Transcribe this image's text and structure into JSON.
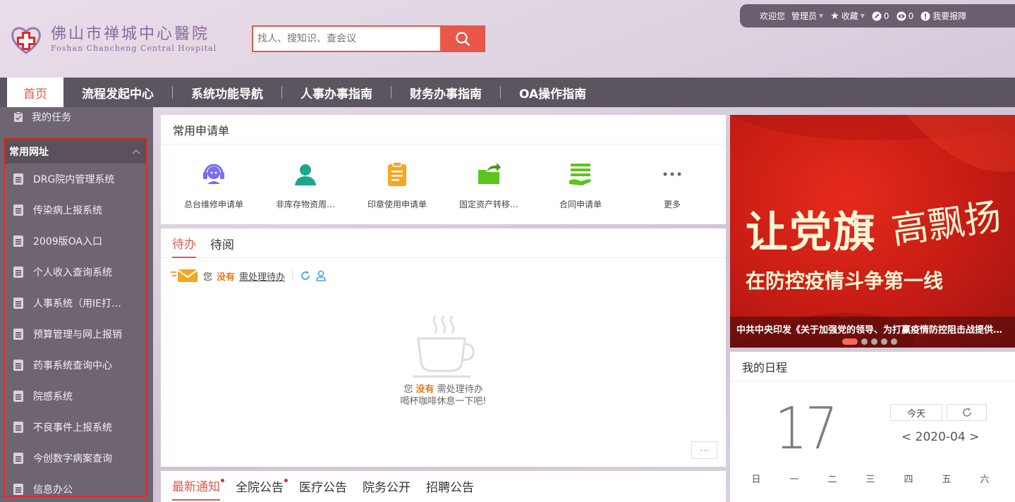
{
  "header": {
    "logo_cn": "佛山市禅城中心醫院",
    "logo_en": "Foshan Chancheng Central Hospital",
    "search_placeholder": "找人、搜知识、查会议"
  },
  "userbar": {
    "welcome": "欢迎您",
    "user": "管理员",
    "favorites": "收藏",
    "edit_count": "0",
    "view_count": "0",
    "report": "我要报障"
  },
  "nav": {
    "items": [
      "首页",
      "流程发起中心",
      "系统功能导航",
      "人事办事指南",
      "财务办事指南",
      "OA操作指南"
    ]
  },
  "sidebar": {
    "task": "我的任务",
    "section_title": "常用网址",
    "items": [
      "DRG院内管理系统",
      "传染病上报系统",
      "2009版OA入口",
      "个人收入查询系统",
      "人事系统（用IE打…",
      "预算管理与网上报销",
      "药事系统查询中心",
      "院感系统",
      "不良事件上报系统",
      "今创数字病案查询",
      "信息办公"
    ]
  },
  "apps": {
    "title": "常用申请单",
    "items": [
      {
        "label": "总台维修申请单",
        "icon": "headset-icon",
        "color": "#7b6cf0"
      },
      {
        "label": "非库存物资周…",
        "icon": "user-icon",
        "color": "#1ba88a"
      },
      {
        "label": "印章使用申请单",
        "icon": "clipboard-icon",
        "color": "#f5a623"
      },
      {
        "label": "固定资产转移…",
        "icon": "folder-share-icon",
        "color": "#5cc51c"
      },
      {
        "label": "合同申请单",
        "icon": "contract-hand-icon",
        "color": "#5cc51c"
      },
      {
        "label": "更多",
        "icon": "more-dots-icon",
        "color": "#666666"
      }
    ]
  },
  "todo": {
    "tabs": [
      "待办",
      "待阅"
    ],
    "line_prefix": "您",
    "line_none": "没有",
    "line_link": "需处理待办",
    "empty_prefix": "您",
    "empty_none": "没有",
    "empty_suffix": "需处理待办",
    "empty_line2": "喝杯咖啡休息一下吧!",
    "more": "···"
  },
  "notice": {
    "tabs": [
      "最新通知",
      "全院公告",
      "医疗公告",
      "院务公开",
      "招聘公告"
    ]
  },
  "banner": {
    "big_text": "让党旗",
    "script_text": "高飘扬",
    "sub_text": "在防控疫情斗争第一线",
    "caption": "中共中央印发《关于加强党的领导、为打赢疫情防控阻击战提供坚强政治保证的通知》",
    "slide_count": 5,
    "active_slide": 1
  },
  "calendar": {
    "title": "我的日程",
    "day": "17",
    "today_btn": "今天",
    "month": "< 2020-04 >",
    "weekdays": [
      "日",
      "一",
      "二",
      "三",
      "四",
      "五",
      "六"
    ]
  },
  "colors": {
    "accent": "#e25a4a",
    "nav_bg": "#5c5560",
    "sidebar_bg": "#6f6572",
    "highlight_box": "#e02a2a"
  }
}
